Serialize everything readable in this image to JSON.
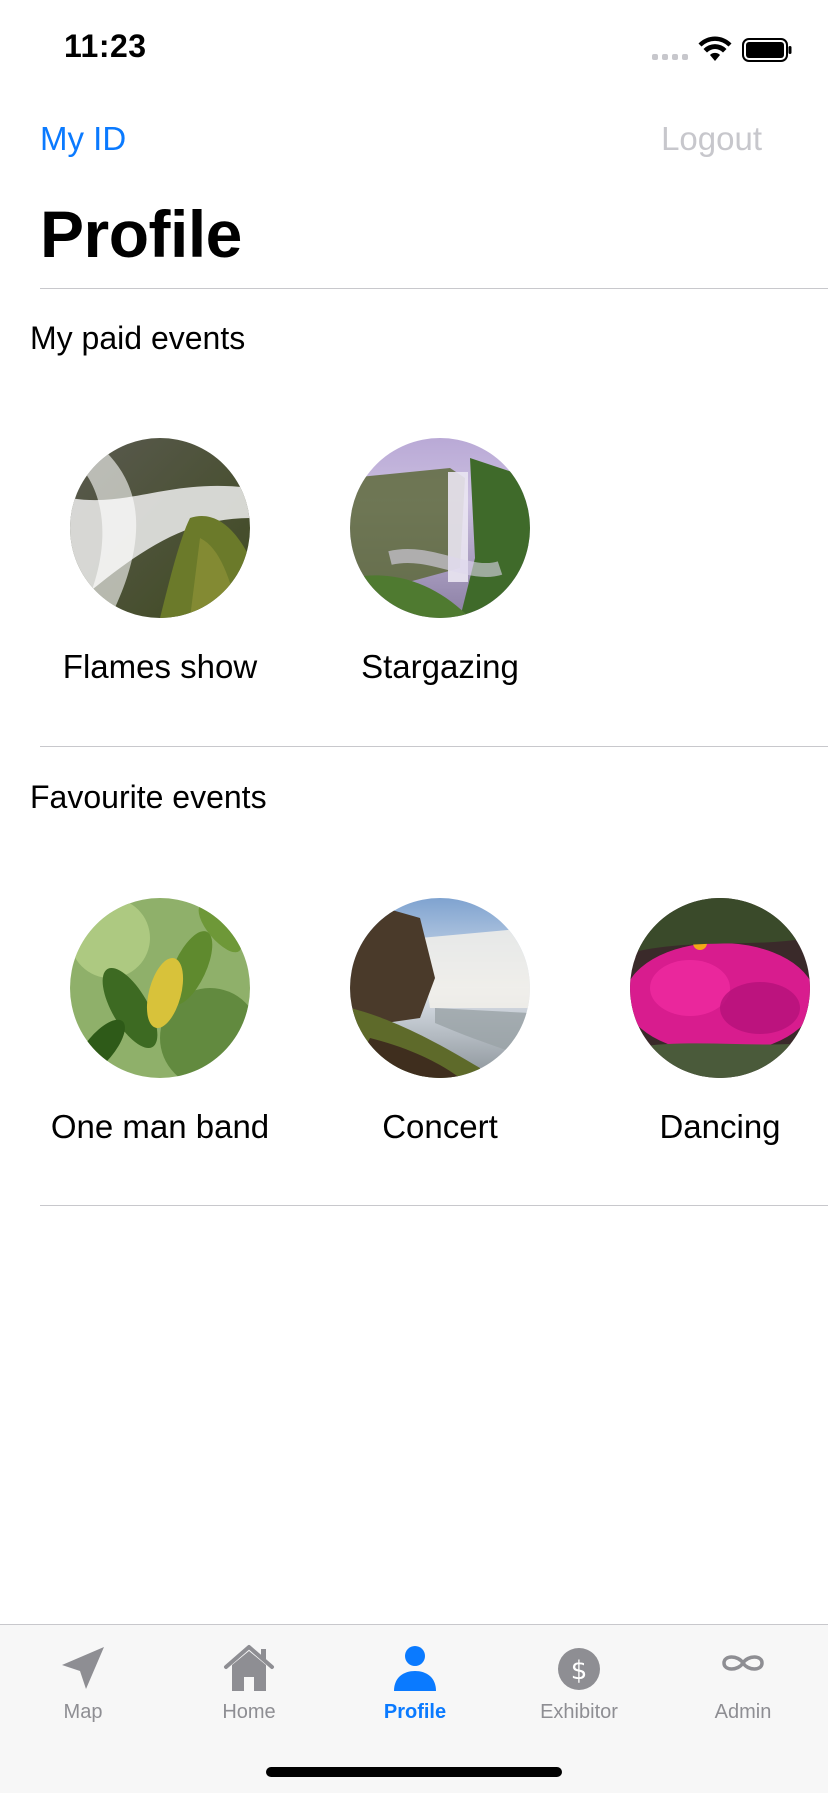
{
  "status_bar": {
    "time": "11:23"
  },
  "nav": {
    "left_label": "My ID",
    "right_label": "Logout"
  },
  "page": {
    "title": "Profile"
  },
  "paid_events": {
    "title": "My paid events",
    "items": [
      {
        "label": "Flames show",
        "icon": "waterfall-rock-photo"
      },
      {
        "label": "Stargazing",
        "icon": "waterfall-cliff-photo"
      }
    ]
  },
  "favourite_events": {
    "title": "Favourite events",
    "items": [
      {
        "label": "One man band",
        "icon": "leaves-photo"
      },
      {
        "label": "Concert",
        "icon": "waterfall-coast-photo"
      },
      {
        "label": "Dancing",
        "icon": "pink-flowers-photo"
      }
    ]
  },
  "tabbar": {
    "tabs": [
      {
        "label": "Map",
        "icon": "location-arrow-icon"
      },
      {
        "label": "Home",
        "icon": "house-icon"
      },
      {
        "label": "Profile",
        "icon": "person-icon",
        "active": true
      },
      {
        "label": "Exhibitor",
        "icon": "dollar-circle-icon"
      },
      {
        "label": "Admin",
        "icon": "infinity-icon"
      }
    ]
  },
  "colors": {
    "accent": "#0a7aff",
    "inactive": "#8e8e93",
    "disabled": "#c7c7cc"
  }
}
